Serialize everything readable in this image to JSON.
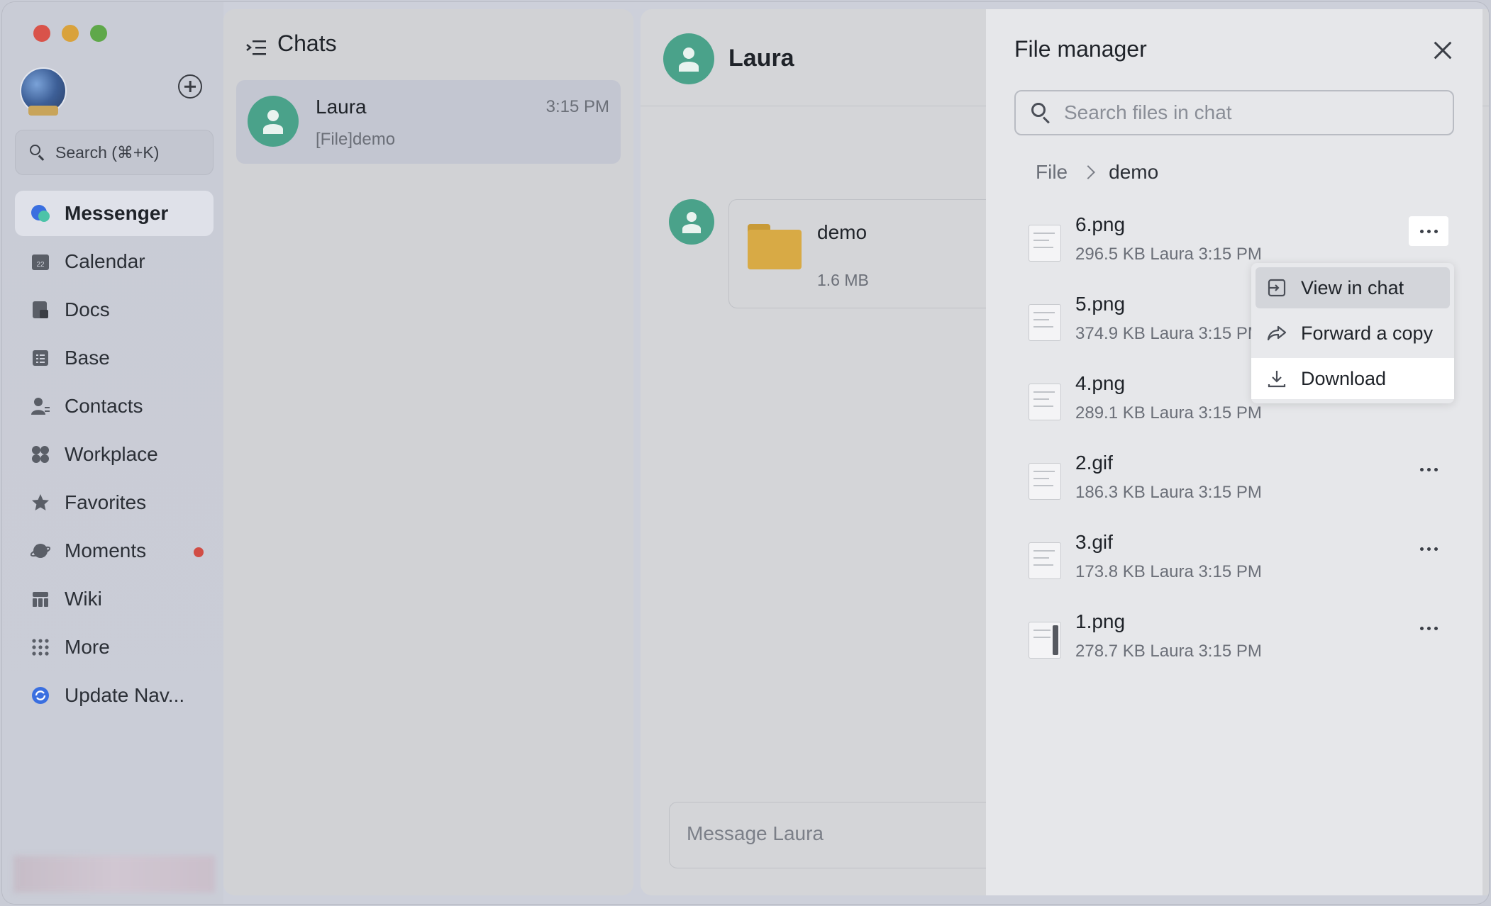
{
  "nav": {
    "search_label": "Search (⌘+K)",
    "items": [
      {
        "label": "Messenger",
        "icon": "messenger-icon"
      },
      {
        "label": "Calendar",
        "icon": "calendar-icon",
        "badge_text": "22"
      },
      {
        "label": "Docs",
        "icon": "docs-icon"
      },
      {
        "label": "Base",
        "icon": "base-icon"
      },
      {
        "label": "Contacts",
        "icon": "contacts-icon"
      },
      {
        "label": "Workplace",
        "icon": "workplace-icon"
      },
      {
        "label": "Favorites",
        "icon": "star-icon"
      },
      {
        "label": "Moments",
        "icon": "moments-icon"
      },
      {
        "label": "Wiki",
        "icon": "wiki-icon"
      },
      {
        "label": "More",
        "icon": "more-grid-icon"
      },
      {
        "label": "Update Nav...",
        "icon": "update-icon"
      }
    ]
  },
  "chats": {
    "title": "Chats",
    "items": [
      {
        "name": "Laura",
        "time": "3:15 PM",
        "preview": "[File]demo"
      }
    ]
  },
  "conversation": {
    "contact_name": "Laura",
    "file_card": {
      "name": "demo",
      "size": "1.6 MB"
    },
    "input_placeholder": "Message Laura"
  },
  "file_manager": {
    "title": "File manager",
    "search_placeholder": "Search files in chat",
    "breadcrumb": {
      "root": "File",
      "current": "demo"
    },
    "files": [
      {
        "name": "6.png",
        "meta": "296.5 KB Laura 3:15 PM"
      },
      {
        "name": "5.png",
        "meta": "374.9 KB Laura 3:15 PM"
      },
      {
        "name": "4.png",
        "meta": "289.1 KB Laura 3:15 PM"
      },
      {
        "name": "2.gif",
        "meta": "186.3 KB Laura 3:15 PM"
      },
      {
        "name": "3.gif",
        "meta": "173.8 KB Laura 3:15 PM"
      },
      {
        "name": "1.png",
        "meta": "278.7 KB Laura 3:15 PM"
      }
    ]
  },
  "context_menu": {
    "items": [
      {
        "label": "View in chat",
        "icon": "view-in-chat-icon"
      },
      {
        "label": "Forward a copy",
        "icon": "forward-icon"
      },
      {
        "label": "Download",
        "icon": "download-icon"
      }
    ]
  },
  "colors": {
    "avatar_green": "#4aa28a",
    "moments_dot": "#d14d45",
    "folder_yellow": "#d8aa45"
  }
}
